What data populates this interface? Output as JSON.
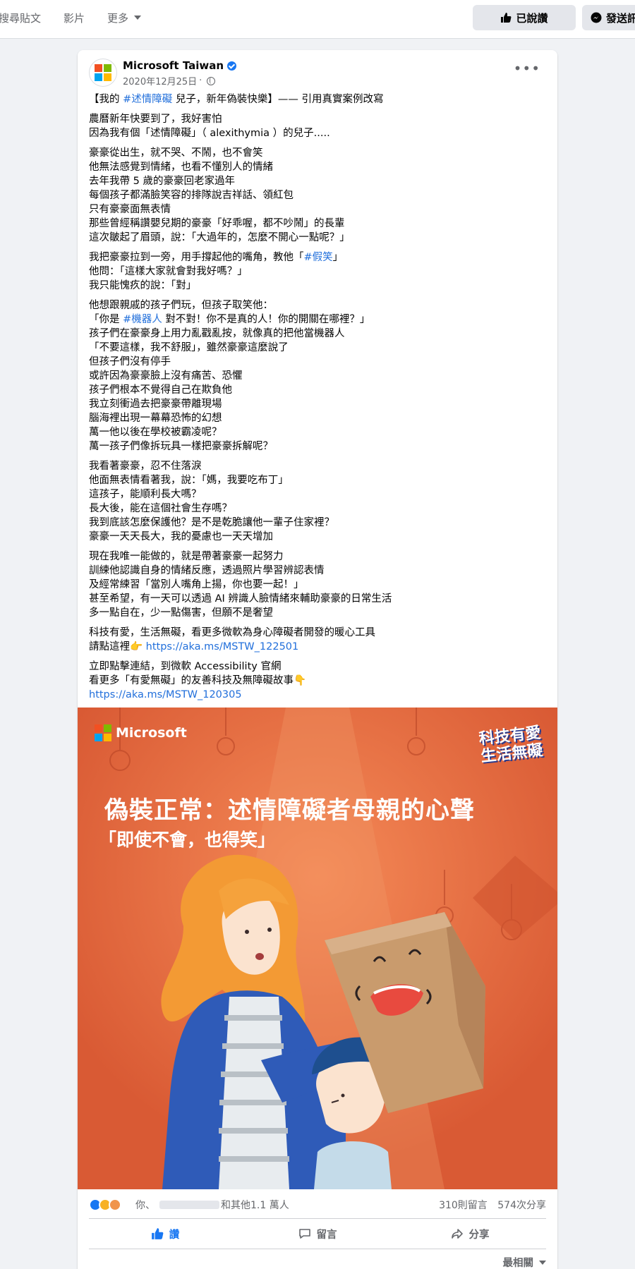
{
  "topnav": {
    "items": [
      "搜尋貼文",
      "影片",
      "更多"
    ],
    "liked_label": "已說讚",
    "message_label": "發送訊息"
  },
  "post": {
    "page_name": "Microsoft Taiwan",
    "date": "2020年12月25日",
    "paragraphs": [
      [
        {
          "t": "【我的 "
        },
        {
          "t": "#述情障礙",
          "hash": true
        },
        {
          "t": " 兒子，新年偽裝快樂】—— 引用真實案例改寫"
        }
      ],
      [
        {
          "t": "農曆新年快要到了，我好害怕"
        },
        {
          "t": "因為我有個「述情障礙」（ alexithymia ）的兒子....."
        }
      ],
      [
        {
          "t": "豪豪從出生，就不哭、不鬧，也不會笑"
        },
        {
          "t": "他無法感覺到情緒，也看不懂別人的情緒"
        },
        {
          "t": "去年我帶 5 歲的豪豪回老家過年"
        },
        {
          "t": "每個孩子都滿臉笑容的排隊說吉祥話、領紅包"
        },
        {
          "t": "只有豪豪面無表情"
        },
        {
          "t": "那些曾經稱讚嬰兒期的豪豪「好乖喔，都不吵鬧」的長輩"
        },
        {
          "t": "這次皺起了眉頭，說：「大過年的，怎麼不開心一點呢？」"
        }
      ],
      [
        {
          "t": "我把豪豪拉到一旁，用手撐起他的嘴角，教他「#假笑」"
        },
        {
          "t": "他問：「這樣大家就會對我好嗎？」"
        },
        {
          "t": "我只能愧疚的說：「對」"
        }
      ],
      [
        {
          "t": "他想跟親戚的孩子們玩，但孩子取笑他："
        },
        {
          "t": "「你是 #機器人 對不對！你不是真的人！你的開關在哪裡？」"
        },
        {
          "t": "孩子們在豪豪身上用力亂戳亂按，就像真的把他當機器人"
        },
        {
          "t": "「不要這樣，我不舒服」，雖然豪豪這麼說了"
        },
        {
          "t": "但孩子們沒有停手"
        },
        {
          "t": "或許因為豪豪臉上沒有痛苦、恐懼"
        },
        {
          "t": "孩子們根本不覺得自己在欺負他"
        },
        {
          "t": "我立刻衝過去把豪豪帶離現場"
        },
        {
          "t": "腦海裡出現一幕幕恐怖的幻想"
        },
        {
          "t": "萬一他以後在學校被霸凌呢？"
        },
        {
          "t": "萬一孩子們像拆玩具一樣把豪豪拆解呢？"
        }
      ],
      [
        {
          "t": "我看著豪豪，忍不住落淚"
        },
        {
          "t": "他面無表情看著我，說：「媽，我要吃布丁」"
        },
        {
          "t": "這孩子，能順利長大嗎？"
        },
        {
          "t": "長大後，能在這個社會生存嗎？"
        },
        {
          "t": "我到底該怎麼保護他？是不是乾脆讓他一輩子住家裡？"
        },
        {
          "t": "豪豪一天天長大，我的憂慮也一天天增加"
        }
      ],
      [
        {
          "t": "現在我唯一能做的，就是帶著豪豪一起努力"
        },
        {
          "t": "訓練他認識自身的情緒反應，透過照片學習辨認表情"
        },
        {
          "t": "及經常練習「當別人嘴角上揚，你也要一起！」"
        },
        {
          "t": "甚至希望，有一天可以透過 AI 辨識人臉情緒來輔助豪豪的日常生活"
        },
        {
          "t": "多一點自在，少一點傷害，但願不是奢望"
        }
      ],
      [
        {
          "t": "科技有愛，生活無礙，看更多微軟為身心障礙者開發的暖心工具"
        },
        {
          "t": "請點這裡👉 https://aka.ms/MSTW_122501"
        }
      ],
      [
        {
          "t": "立即點擊連結，到微軟 Accessibility 官網"
        },
        {
          "t": "看更多「有愛無礙」的友善科技及無障礙故事👇"
        },
        {
          "t": "https://aka.ms/MSTW_120305"
        }
      ]
    ],
    "image": {
      "brand": "Microsoft",
      "badge_line1": "科技有愛",
      "badge_line2": "生活無礙",
      "title": "偽裝正常：述情障礙者母親的心聲",
      "subtitle": "「即使不會，也得笑」"
    },
    "reactions": {
      "you": "你、",
      "others": "和其他1.1 萬人",
      "comments": "310則留言",
      "shares": "574次分享"
    },
    "actions": {
      "like": "讚",
      "comment": "留言",
      "share": "分享"
    },
    "sort_label": "最相關"
  },
  "colors": {
    "ms_red": "#f25022",
    "ms_green": "#7fba00",
    "ms_blue": "#00a4ef",
    "ms_yellow": "#ffb900",
    "fb_blue": "#1877f2",
    "link": "#216fdb",
    "image_bg": "#e46e43"
  }
}
